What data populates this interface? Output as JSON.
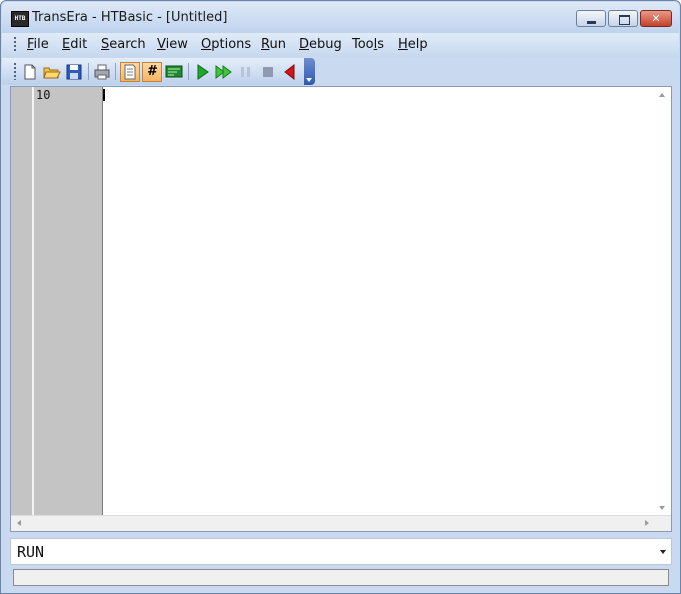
{
  "window": {
    "title": "TransEra - HTBasic - [Untitled]",
    "app_icon_text": "HTB"
  },
  "menu": [
    {
      "label": "File",
      "mnemonic": "F"
    },
    {
      "label": "Edit",
      "mnemonic": "E"
    },
    {
      "label": "Search",
      "mnemonic": "S"
    },
    {
      "label": "View",
      "mnemonic": "V"
    },
    {
      "label": "Options",
      "mnemonic": "O"
    },
    {
      "label": "Run",
      "mnemonic": "R"
    },
    {
      "label": "Debug",
      "mnemonic": "D"
    },
    {
      "label": "Tools",
      "mnemonic": "l"
    },
    {
      "label": "Help",
      "mnemonic": "H"
    }
  ],
  "toolbar": {
    "buttons": [
      {
        "name": "new-file-icon",
        "state": "normal"
      },
      {
        "name": "open-folder-icon",
        "state": "normal"
      },
      {
        "name": "save-disk-icon",
        "state": "normal"
      },
      {
        "name": "print-icon",
        "state": "normal"
      },
      {
        "name": "edit-mode-icon",
        "state": "active"
      },
      {
        "name": "line-numbers-icon",
        "state": "active",
        "glyph": "#"
      },
      {
        "name": "output-screen-icon",
        "state": "normal"
      },
      {
        "name": "run-icon",
        "state": "normal"
      },
      {
        "name": "continue-icon",
        "state": "normal"
      },
      {
        "name": "pause-icon",
        "state": "disabled"
      },
      {
        "name": "stop-icon",
        "state": "disabled"
      },
      {
        "name": "step-back-icon",
        "state": "normal"
      }
    ]
  },
  "editor": {
    "line_number": "10",
    "code": ""
  },
  "command_line": {
    "value": "RUN"
  },
  "statusbar": {
    "text": ""
  },
  "colors": {
    "title_bg": "#c9daf0",
    "close_red": "#c3412b",
    "gutter_gray": "#c4c4c4",
    "active_tool": "#f5b562"
  }
}
